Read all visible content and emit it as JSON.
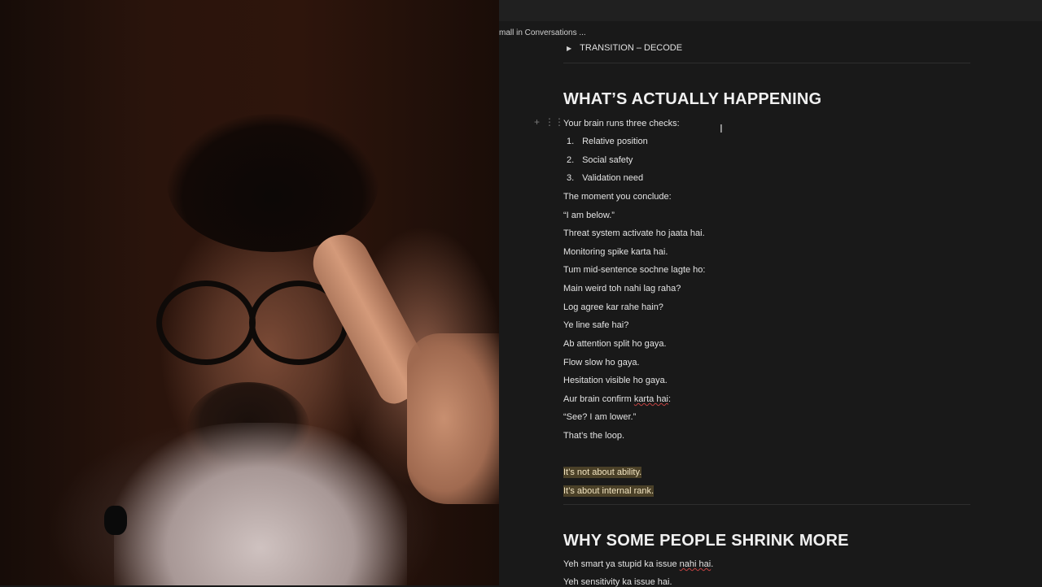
{
  "breadcrumb": "mall in Conversations ...",
  "toggle": {
    "label": "TRANSITION – DECODE"
  },
  "section1": {
    "heading": "WHAT’S ACTUALLY HAPPENING",
    "intro": "Your brain runs three checks:",
    "list": [
      {
        "num": "1.",
        "text": "Relative position"
      },
      {
        "num": "2.",
        "text": "Social safety"
      },
      {
        "num": "3.",
        "text": "Validation need"
      }
    ],
    "lines": [
      "The moment you conclude:",
      "“I am below.”",
      "Threat system activate ho jaata hai.",
      "Monitoring spike karta hai.",
      "Tum mid-sentence sochne lagte ho:",
      "Main weird toh nahi lag raha?",
      "Log agree kar rahe hain?",
      "Ye line safe hai?",
      "Ab attention split ho gaya.",
      "Flow slow ho gaya.",
      "Hesitation visible ho gaya."
    ],
    "confirm_prefix": "Aur brain confirm ",
    "confirm_squiggle": "karta hai",
    "confirm_suffix": ":",
    "see_line": "“See? I am lower.”",
    "loop_line": "That’s the loop.",
    "highlight1": "It’s not about ability.",
    "highlight2": "It’s about internal rank."
  },
  "section2": {
    "heading": "WHY SOME PEOPLE SHRINK MORE",
    "line1_prefix": "Yeh smart ya stupid ka issue ",
    "line1_squiggle": "nahi hai",
    "line1_suffix": ".",
    "line2": "Yeh sensitivity ka issue hai."
  },
  "icons": {
    "plus": "+",
    "drag": "⋮⋮",
    "toggle_arrow": "▶",
    "text_cursor": "I"
  },
  "colors": {
    "background": "#191919",
    "highlight_bg": "#4b4128",
    "spell_error": "#c14242"
  }
}
